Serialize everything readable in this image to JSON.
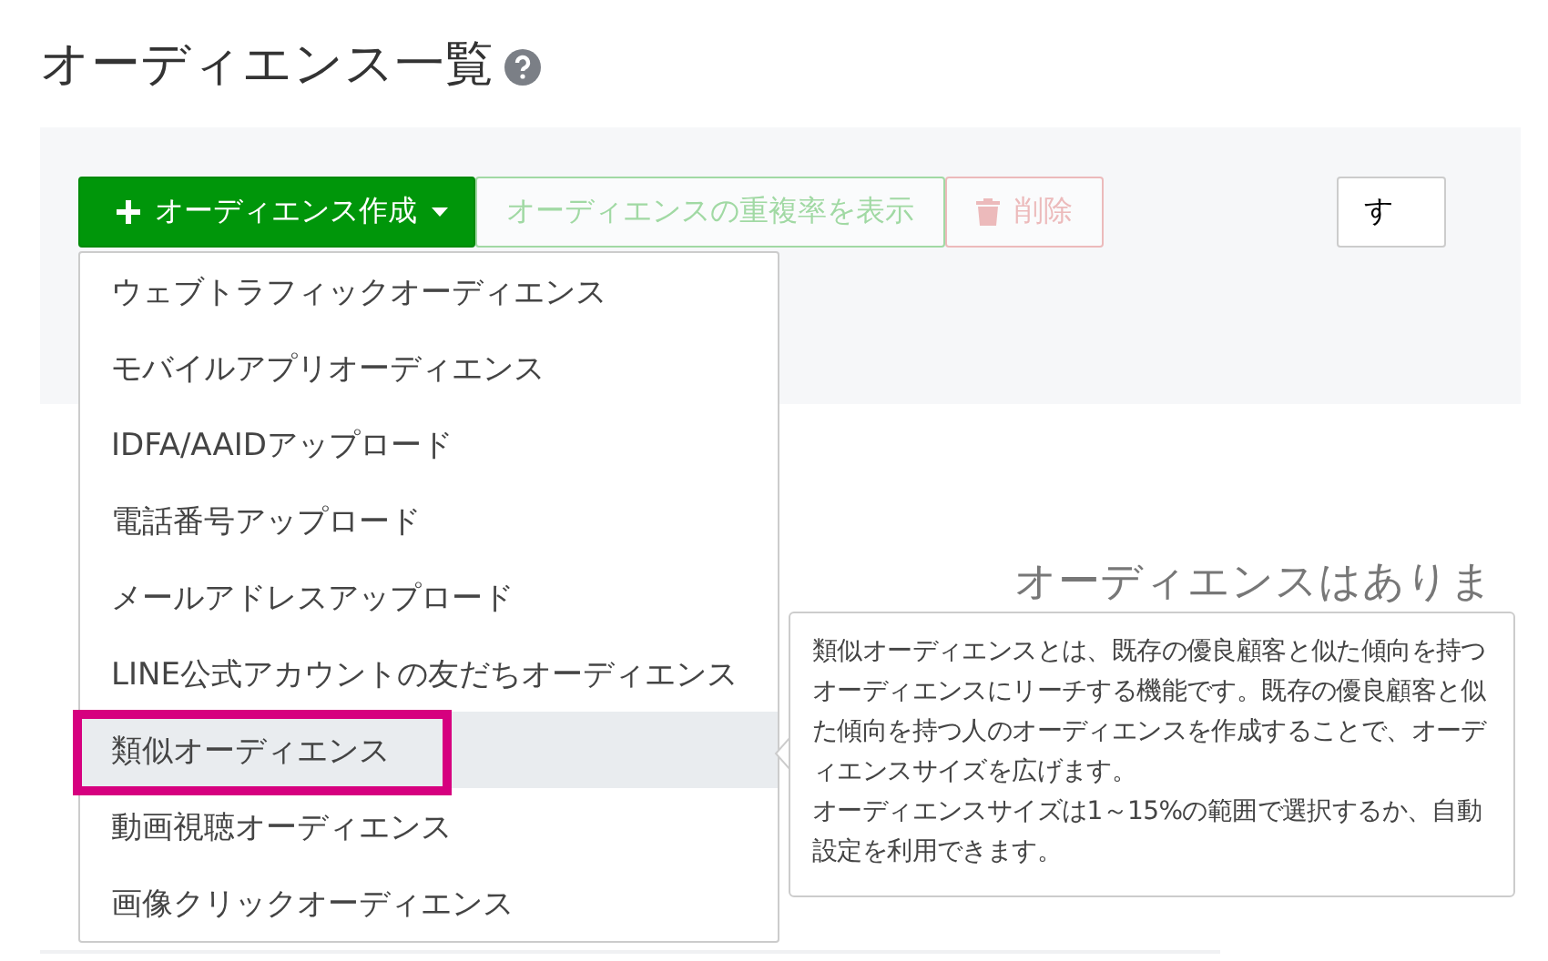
{
  "page": {
    "title": "オーディエンス一覧"
  },
  "toolbar": {
    "create_button": "オーディエンス作成",
    "overlap_button": {
      "label": "オーディエンスの重複率を表示",
      "disabled": true
    },
    "delete_button": {
      "label": "削除",
      "disabled": true
    },
    "filter_button": "す"
  },
  "empty_message": "オーディエンスはありま",
  "menu": {
    "items": [
      {
        "label": "ウェブトラフィックオーディエンス",
        "selected": false
      },
      {
        "label": "モバイルアプリオーディエンス",
        "selected": false
      },
      {
        "label": "IDFA/AAIDアップロード",
        "selected": false
      },
      {
        "label": "電話番号アップロード",
        "selected": false
      },
      {
        "label": "メールアドレスアップロード",
        "selected": false
      },
      {
        "label": "LINE公式アカウントの友だちオーディエンス",
        "selected": false
      },
      {
        "label": "類似オーディエンス",
        "selected": true
      },
      {
        "label": "動画視聴オーディエンス",
        "selected": false
      },
      {
        "label": "画像クリックオーディエンス",
        "selected": false
      }
    ]
  },
  "tooltip": {
    "paragraphs": [
      "類似オーディエンスとは、既存の優良顧客と似た傾向を持つオーディエンスにリーチする機能です。既存の優良顧客と似た傾向を持つ人のオーディエンスを作成することで、オーディエンスサイズを広げます。",
      "オーディエンスサイズは1～15%の範囲で選択するか、自動設定を利用できます。"
    ]
  }
}
